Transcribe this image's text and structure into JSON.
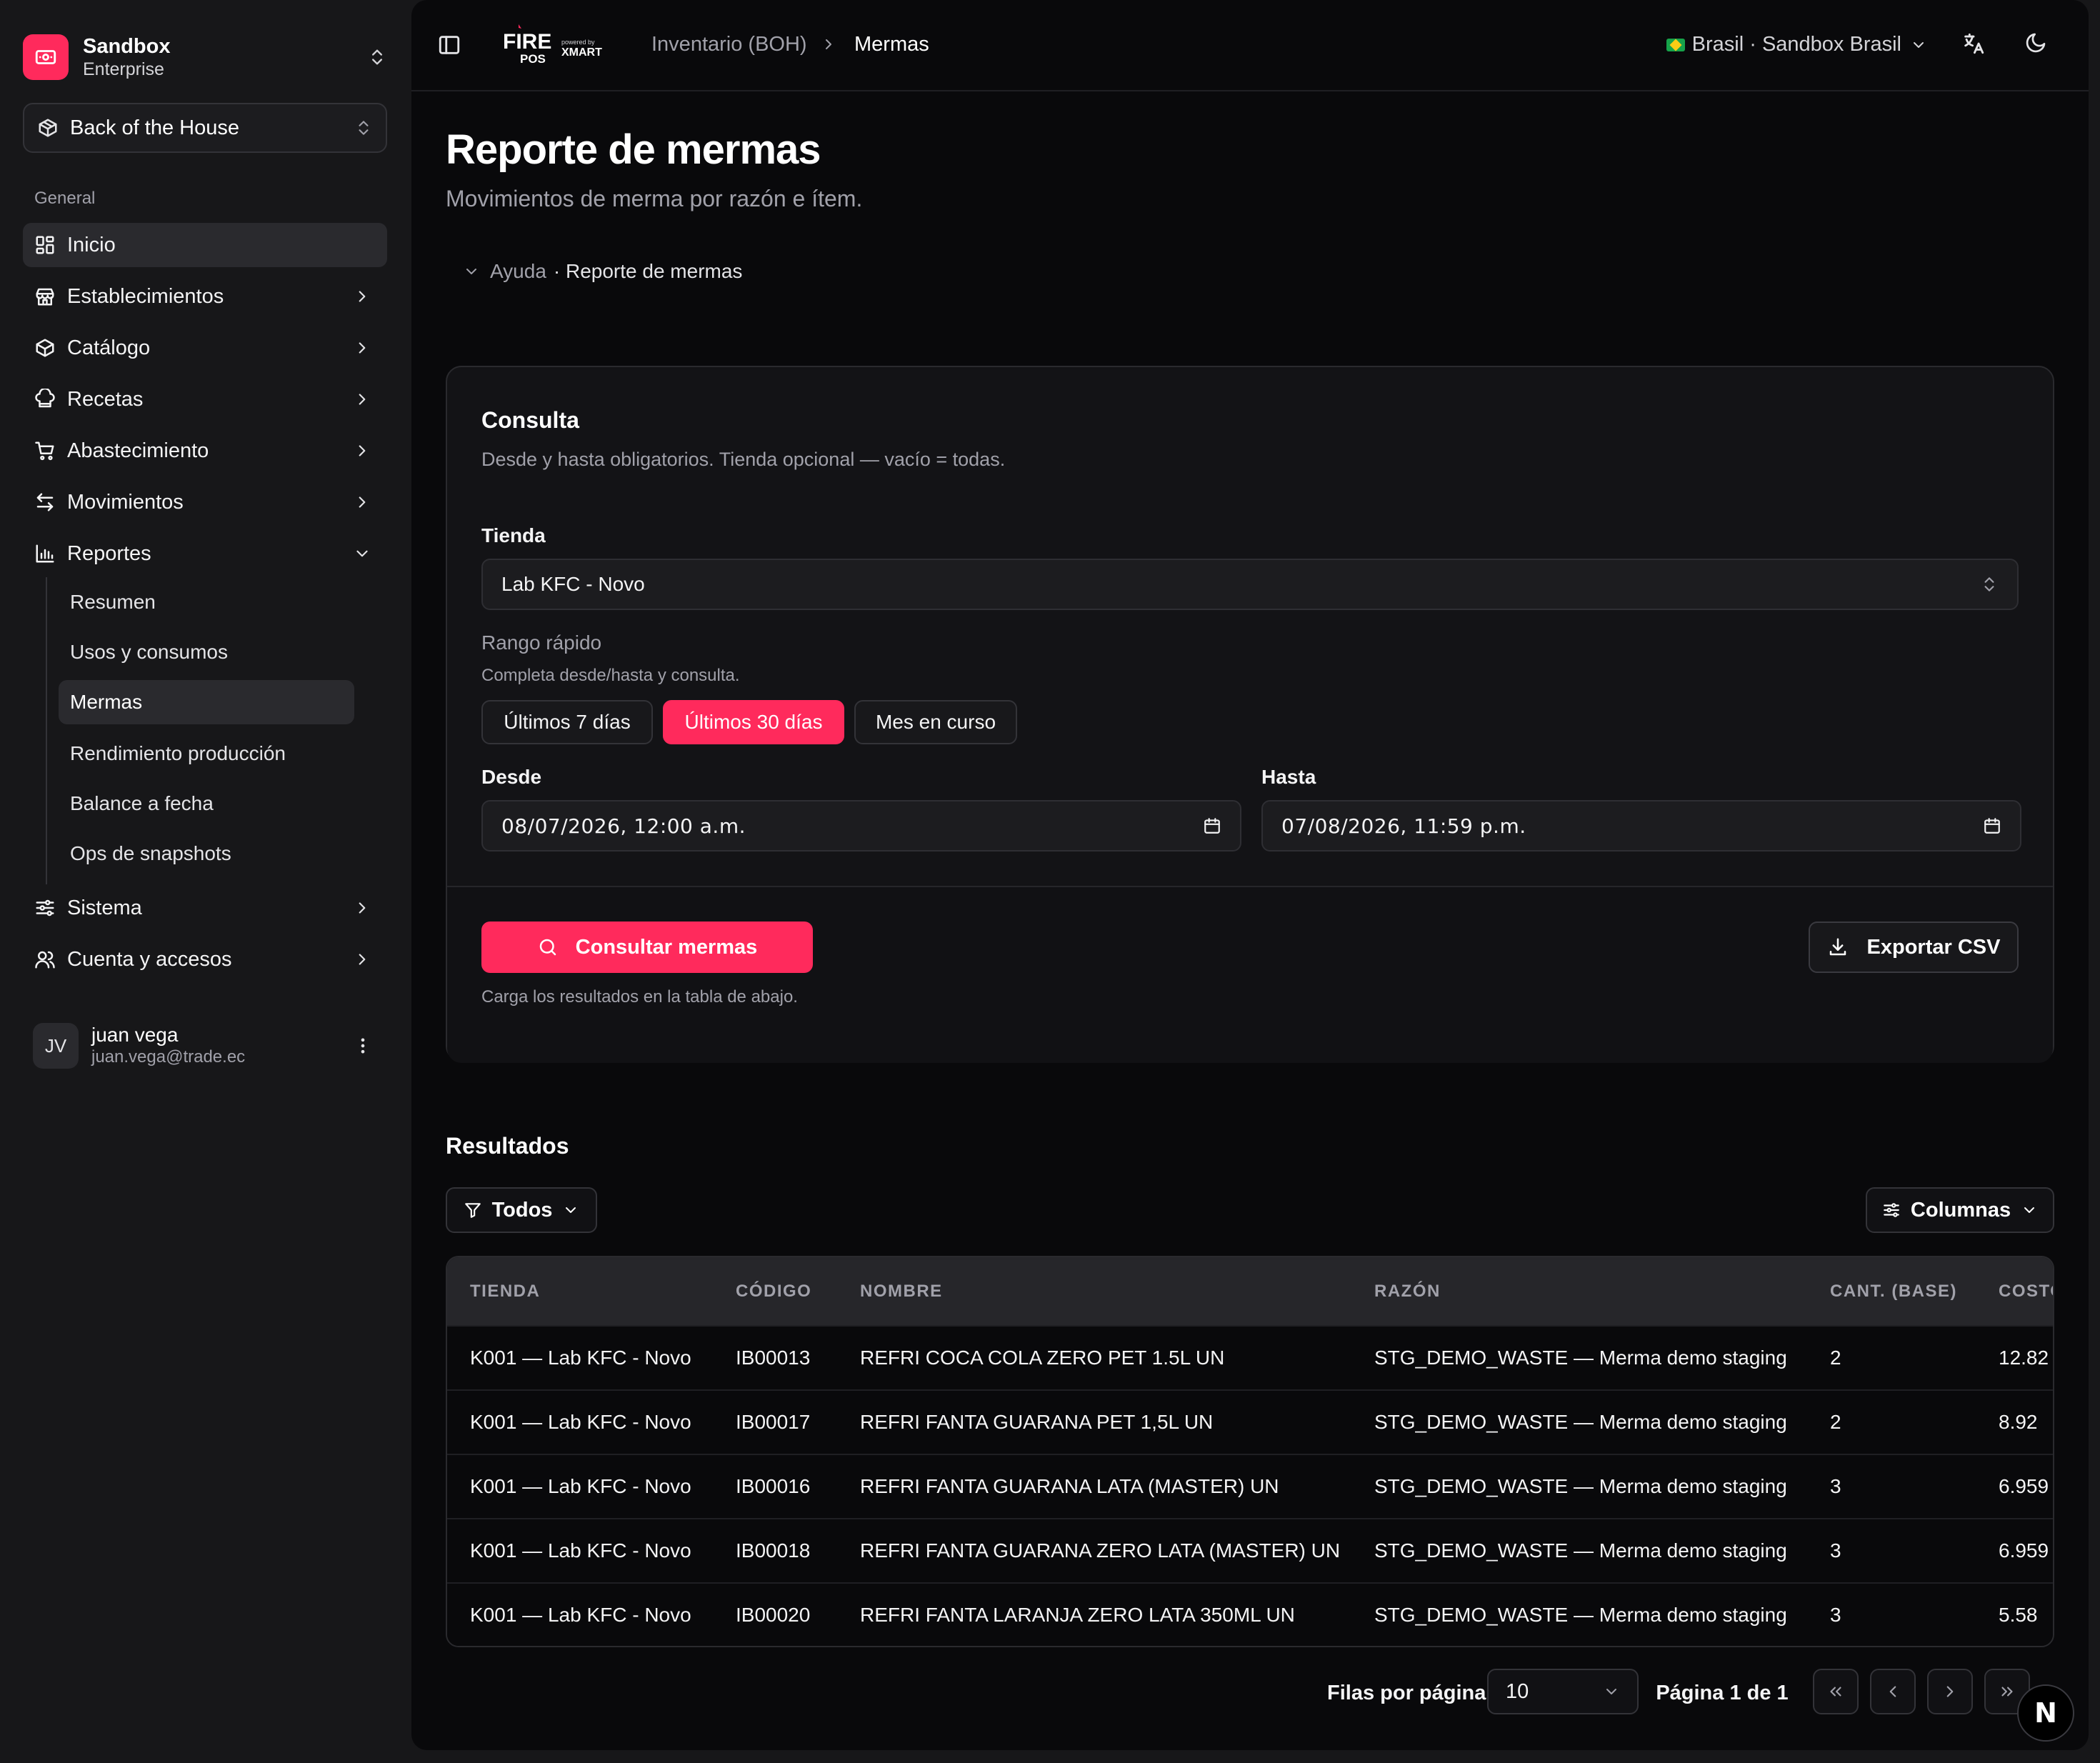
{
  "org": {
    "name": "Sandbox",
    "plan": "Enterprise"
  },
  "module": {
    "label": "Back of the House"
  },
  "nav": {
    "section": "General",
    "items": [
      {
        "label": "Inicio"
      },
      {
        "label": "Establecimientos"
      },
      {
        "label": "Catálogo"
      },
      {
        "label": "Recetas"
      },
      {
        "label": "Abastecimiento"
      },
      {
        "label": "Movimientos"
      },
      {
        "label": "Reportes"
      },
      {
        "label": "Sistema"
      },
      {
        "label": "Cuenta y accesos"
      }
    ],
    "reportes_sub": [
      {
        "label": "Resumen"
      },
      {
        "label": "Usos y consumos"
      },
      {
        "label": "Mermas"
      },
      {
        "label": "Rendimiento producción"
      },
      {
        "label": "Balance a fecha"
      },
      {
        "label": "Ops de snapshots"
      }
    ]
  },
  "user": {
    "initials": "JV",
    "name": "juan vega",
    "email": "juan.vega@trade.ec"
  },
  "topbar": {
    "brand_main": "FIRE",
    "brand_sub": "POS",
    "brand_powered": "powered by",
    "brand_partner": "XMART",
    "breadcrumb": [
      "Inventario (BOH)",
      "Mermas"
    ],
    "region": "Brasil · Sandbox Brasil"
  },
  "page": {
    "title": "Reporte de mermas",
    "subtitle": "Movimientos de merma por razón e ítem.",
    "help_label": "Ayuda",
    "help_topic": "· Reporte de mermas"
  },
  "query": {
    "title": "Consulta",
    "description": "Desde y hasta obligatorios. Tienda opcional — vacío = todas.",
    "store_label": "Tienda",
    "store_value": "Lab KFC - Novo",
    "range_label": "Rango rápido",
    "range_hint": "Completa desde/hasta y consulta.",
    "ranges": [
      "Últimos 7 días",
      "Últimos 30 días",
      "Mes en curso"
    ],
    "from_label": "Desde",
    "from_value": "08/07/2026, 12:00 a.m.",
    "to_label": "Hasta",
    "to_value": "07/08/2026, 11:59 p.m.",
    "submit_label": "Consultar mermas",
    "submit_hint": "Carga los resultados en la tabla de abajo.",
    "export_label": "Exportar CSV"
  },
  "results": {
    "title": "Resultados",
    "filter_label": "Todos",
    "columns_label": "Columnas",
    "headers": [
      "TIENDA",
      "CÓDIGO",
      "NOMBRE",
      "RAZÓN",
      "CANT. (BASE)",
      "COSTO"
    ],
    "rows": [
      [
        "K001 — Lab KFC - Novo",
        "IB00013",
        "REFRI COCA COLA ZERO PET 1.5L UN",
        "STG_DEMO_WASTE — Merma demo staging",
        "2",
        "12.82"
      ],
      [
        "K001 — Lab KFC - Novo",
        "IB00017",
        "REFRI FANTA GUARANA PET 1,5L UN",
        "STG_DEMO_WASTE — Merma demo staging",
        "2",
        "8.92"
      ],
      [
        "K001 — Lab KFC - Novo",
        "IB00016",
        "REFRI FANTA GUARANA LATA (MASTER) UN",
        "STG_DEMO_WASTE — Merma demo staging",
        "3",
        "6.959"
      ],
      [
        "K001 — Lab KFC - Novo",
        "IB00018",
        "REFRI FANTA GUARANA ZERO LATA (MASTER) UN",
        "STG_DEMO_WASTE — Merma demo staging",
        "3",
        "6.959"
      ],
      [
        "K001 — Lab KFC - Novo",
        "IB00020",
        "REFRI FANTA LARANJA ZERO LATA 350ML UN",
        "STG_DEMO_WASTE — Merma demo staging",
        "3",
        "5.58"
      ]
    ]
  },
  "pagination": {
    "rows_label": "Filas por página",
    "rows_value": "10",
    "page_label": "Página 1 de 1"
  },
  "badge": {
    "letter": "N"
  },
  "colors": {
    "accent": "#ff2a5c",
    "background": "#09090b",
    "sidebar": "#171719"
  }
}
